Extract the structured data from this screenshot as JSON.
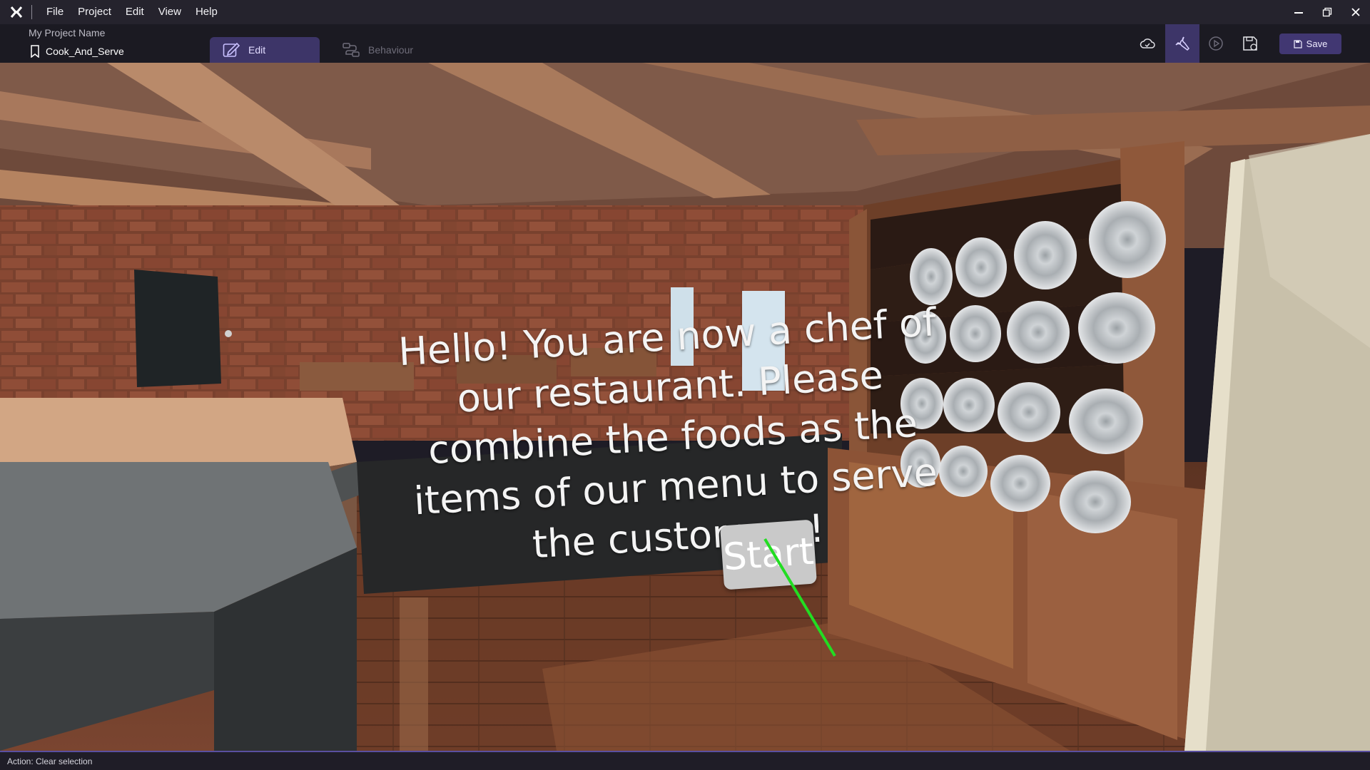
{
  "menu": {
    "items": [
      "File",
      "Project",
      "Edit",
      "View",
      "Help"
    ]
  },
  "project": {
    "name": "My Project Name",
    "scene": "Cook_And_Serve"
  },
  "tabs": {
    "edit": "Edit",
    "behaviour": "Behaviour"
  },
  "toolbar": {
    "save_label": "Save"
  },
  "viewport": {
    "welcome_text": "Hello! You are now a chef of our restaurant. Please combine the foods as the items of our menu to serve the customers!",
    "start_label": "Start"
  },
  "status": {
    "text": "Action: Clear selection"
  },
  "colors": {
    "accent": "#3d3568",
    "save_button": "#413772",
    "laser": "#22dd22"
  },
  "icons": {
    "logo": "app-logo-icon",
    "scene": "bookmark-icon",
    "edit_tab": "edit-pencil-icon",
    "behaviour_tab": "behaviour-flow-icon",
    "cloud": "cloud-icon",
    "tools": "wrench-icon",
    "play": "play-icon",
    "save_build": "save-build-icon",
    "save": "floppy-icon"
  }
}
